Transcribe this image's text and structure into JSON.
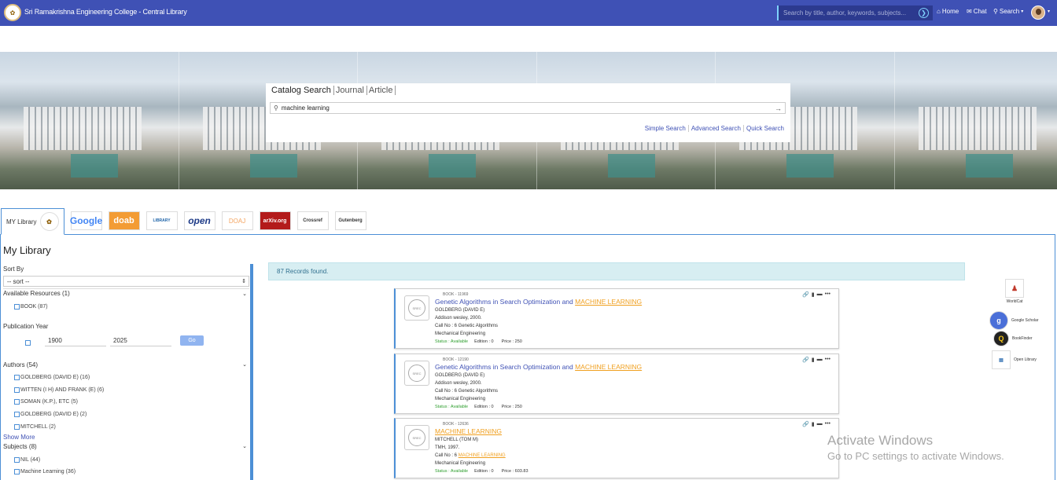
{
  "navbar": {
    "brand": "Sri Ramakrishna Engineering College - Central Library",
    "search_placeholder": "Search by title, author, keywords, subjects...",
    "home": "Home",
    "chat": "Chat",
    "search": "Search",
    "icons": {
      "home": "home-icon",
      "chat": "chat-icon",
      "search": "search-icon"
    }
  },
  "catalog": {
    "tabs": [
      {
        "label": "Catalog Search"
      },
      {
        "label": "Journal"
      },
      {
        "label": "Article"
      }
    ],
    "query": "machine learning",
    "links": [
      "Simple Search",
      "Advanced Search",
      "Quick Search"
    ]
  },
  "resource_tabs": {
    "my_library": "MY Library",
    "logos": [
      "Google",
      "doab",
      "LIBRARY",
      "open",
      "DOAJ",
      "arXiv.org",
      "Crossref",
      "Gutenberg"
    ]
  },
  "main": {
    "title": "My Library",
    "records_found": "87 Records found."
  },
  "sidebar": {
    "sort_by": "Sort By",
    "sort_value": "-- sort --",
    "available_resources": "Available Resources (1)",
    "resources": [
      "BOOK (87)"
    ],
    "publication_year": "Publication Year",
    "year_from": "1900",
    "year_to": "2025",
    "go": "Go",
    "authors_header": "Authors (54)",
    "authors": [
      "GOLDBERG (DAVID E) (16)",
      "WITTEN (I H) AND FRANK (E) (6)",
      "SOMAN (K.P.), ETC (5)",
      "GOLDBERG (DAVID E) (2)",
      "MITCHELL (2)"
    ],
    "show_more": "Show More",
    "subjects_header": "Subjects (8)",
    "subjects": [
      "NIL (44)",
      "Machine Learning (36)"
    ]
  },
  "results": [
    {
      "tag": "BOOK - 11969",
      "title_pre": "Genetic Algorithms in Search Optimization and ",
      "title_hl": "MACHINE LEARNING",
      "author": "GOLDBERG (DAVID E)",
      "publisher": "Addison wesley, 2000.",
      "call_pre": "Call No : 6  Genetic Algorithms",
      "call_hl": "",
      "dept": "Mechanical Engineering",
      "status": "Status : Available",
      "edition": "Edition : 0",
      "price": "Price : 250"
    },
    {
      "tag": "BOOK - 12190",
      "title_pre": "Genetic Algorithms in Search Optimization and ",
      "title_hl": "MACHINE LEARNING",
      "author": "GOLDBERG (DAVID E)",
      "publisher": "Addison wesley, 2000.",
      "call_pre": "Call No : 6  Genetic Algorithms",
      "call_hl": "",
      "dept": "Mechanical Engineering",
      "status": "Status : Available",
      "edition": "Edition : 0",
      "price": "Price : 250"
    },
    {
      "tag": "BOOK - 12636",
      "title_pre": "",
      "title_hl": "MACHINE LEARNING",
      "author": "MITCHELL (TOM M)",
      "publisher": "TMH, 1997.",
      "call_pre": "Call No : 6  ",
      "call_hl": "MACHINE LEARNING",
      "dept": "Mechanical Engineering",
      "status": "Status : Available",
      "edition": "Edition : 0",
      "price": "Price : 603.83"
    }
  ],
  "side_links": [
    "WorldCat",
    "Google Scholar",
    "BookFinder",
    "Open Library"
  ],
  "watermark": {
    "line1": "Activate Windows",
    "line2": "Go to PC settings to activate Windows."
  }
}
